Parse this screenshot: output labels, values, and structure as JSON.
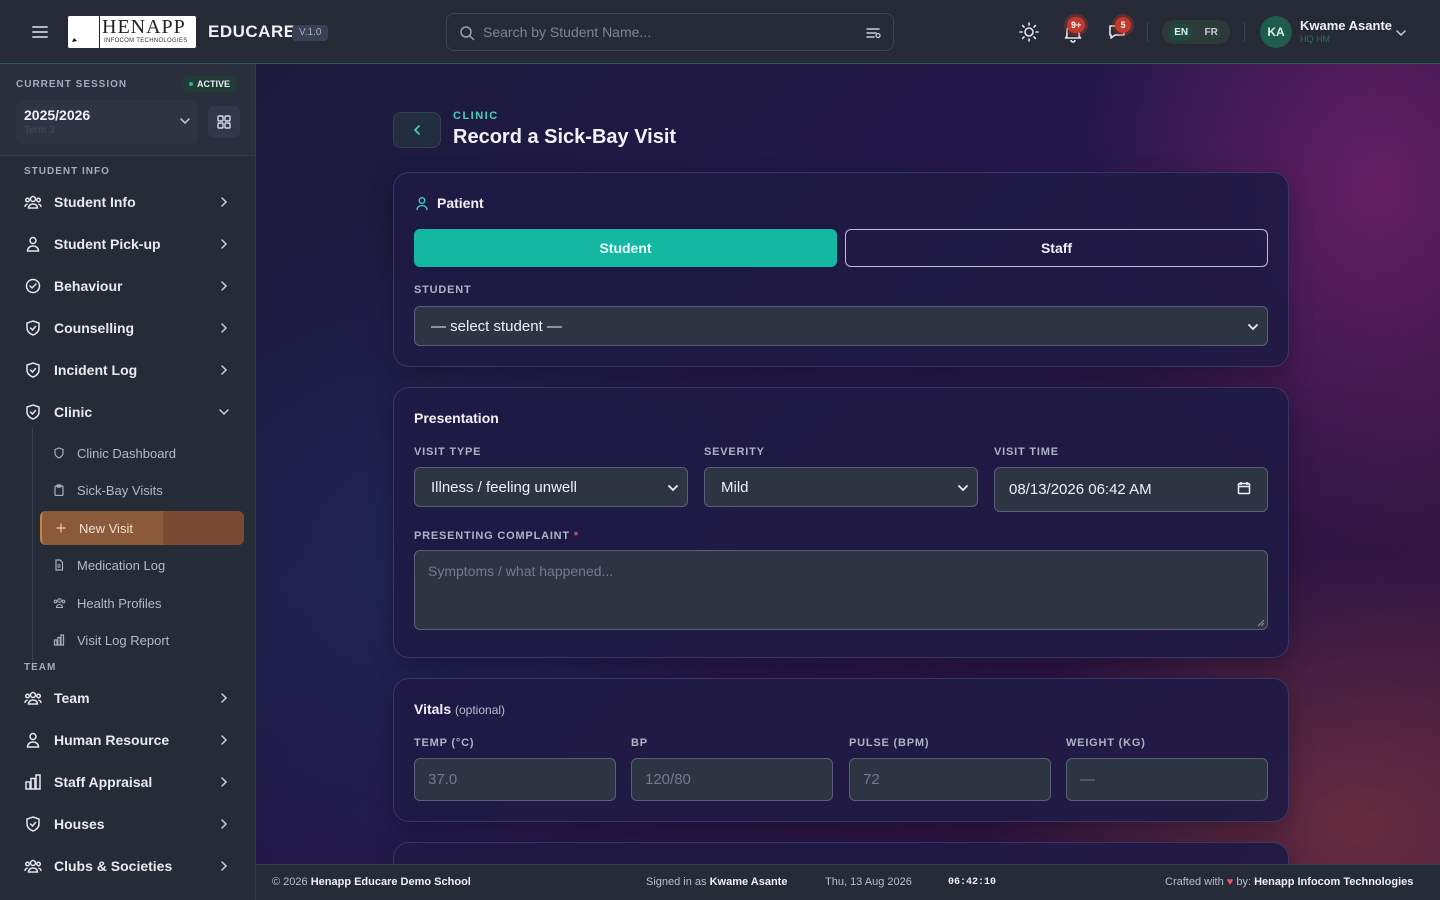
{
  "header": {
    "logo_text": "HENAPP",
    "logo_sub": "INFOCOM TECHNOLOGIES",
    "brand": "EDUCARE",
    "version": "V.1.0",
    "search_placeholder": "Search by Student Name...",
    "notifications_badge": "9+",
    "messages_badge": "5",
    "lang_active": "EN",
    "lang_other": "FR",
    "avatar_initials": "KA",
    "user_name": "Kwame Asante",
    "user_role": "HQ HM"
  },
  "sidebar": {
    "session_label": "CURRENT SESSION",
    "session_status": "ACTIVE",
    "session_year": "2025/2026",
    "session_term": "Term 3",
    "section_student": "STUDENT INFO",
    "section_team": "TEAM",
    "items": [
      {
        "label": "Student Info",
        "icon": "users-icon"
      },
      {
        "label": "Student Pick-up",
        "icon": "user-icon"
      },
      {
        "label": "Behaviour",
        "icon": "check-circle-icon"
      },
      {
        "label": "Counselling",
        "icon": "shield-check-icon"
      },
      {
        "label": "Incident Log",
        "icon": "shield-check-icon"
      },
      {
        "label": "Clinic",
        "icon": "shield-check-icon"
      }
    ],
    "clinic_sub": [
      {
        "label": "Clinic Dashboard",
        "icon": "shield-icon"
      },
      {
        "label": "Sick-Bay Visits",
        "icon": "clipboard-icon"
      },
      {
        "label": "New Visit",
        "icon": "plus-icon"
      },
      {
        "label": "Medication Log",
        "icon": "document-icon"
      },
      {
        "label": "Health Profiles",
        "icon": "users-icon"
      },
      {
        "label": "Visit Log Report",
        "icon": "bar-chart-icon"
      }
    ],
    "team_items": [
      {
        "label": "Team",
        "icon": "users-icon"
      },
      {
        "label": "Human Resource",
        "icon": "user-icon"
      },
      {
        "label": "Staff Appraisal",
        "icon": "bar-chart-icon"
      },
      {
        "label": "Houses",
        "icon": "shield-check-icon"
      },
      {
        "label": "Clubs & Societies",
        "icon": "users-icon"
      }
    ]
  },
  "page": {
    "breadcrumb": "CLINIC",
    "title": "Record a Sick-Bay Visit"
  },
  "patient": {
    "title": "Patient",
    "tab_student": "Student",
    "tab_staff": "Staff",
    "student_label": "STUDENT",
    "student_value": "— select student —"
  },
  "presentation": {
    "title": "Presentation",
    "visit_type_label": "VISIT TYPE",
    "visit_type_value": "Illness / feeling unwell",
    "severity_label": "SEVERITY",
    "severity_value": "Mild",
    "visit_time_label": "VISIT TIME",
    "visit_time_value": "08/13/2026 06:42 AM",
    "complaint_label": "PRESENTING COMPLAINT",
    "complaint_required": "*",
    "complaint_placeholder": "Symptoms / what happened..."
  },
  "vitals": {
    "title": "Vitals",
    "optional": "(optional)",
    "temp_label": "TEMP (°C)",
    "temp_placeholder": "37.0",
    "bp_label": "BP",
    "bp_placeholder": "120/80",
    "pulse_label": "PULSE (BPM)",
    "pulse_placeholder": "72",
    "weight_label": "WEIGHT (KG)",
    "weight_placeholder": "—"
  },
  "footer": {
    "copyright_prefix": "© 2026",
    "school": "Henapp Educare Demo School",
    "signed_prefix": "Signed in as",
    "signed_user": "Kwame Asante",
    "date": "Thu, 13 Aug 2026",
    "clock": "06:42:10",
    "crafted_prefix": "Crafted with",
    "crafted_by": "by:",
    "company": "Henapp Infocom Technologies"
  },
  "colors": {
    "accent": "#14b8a2",
    "highlight": "#8a5a3a",
    "badge": "#c0392b"
  }
}
